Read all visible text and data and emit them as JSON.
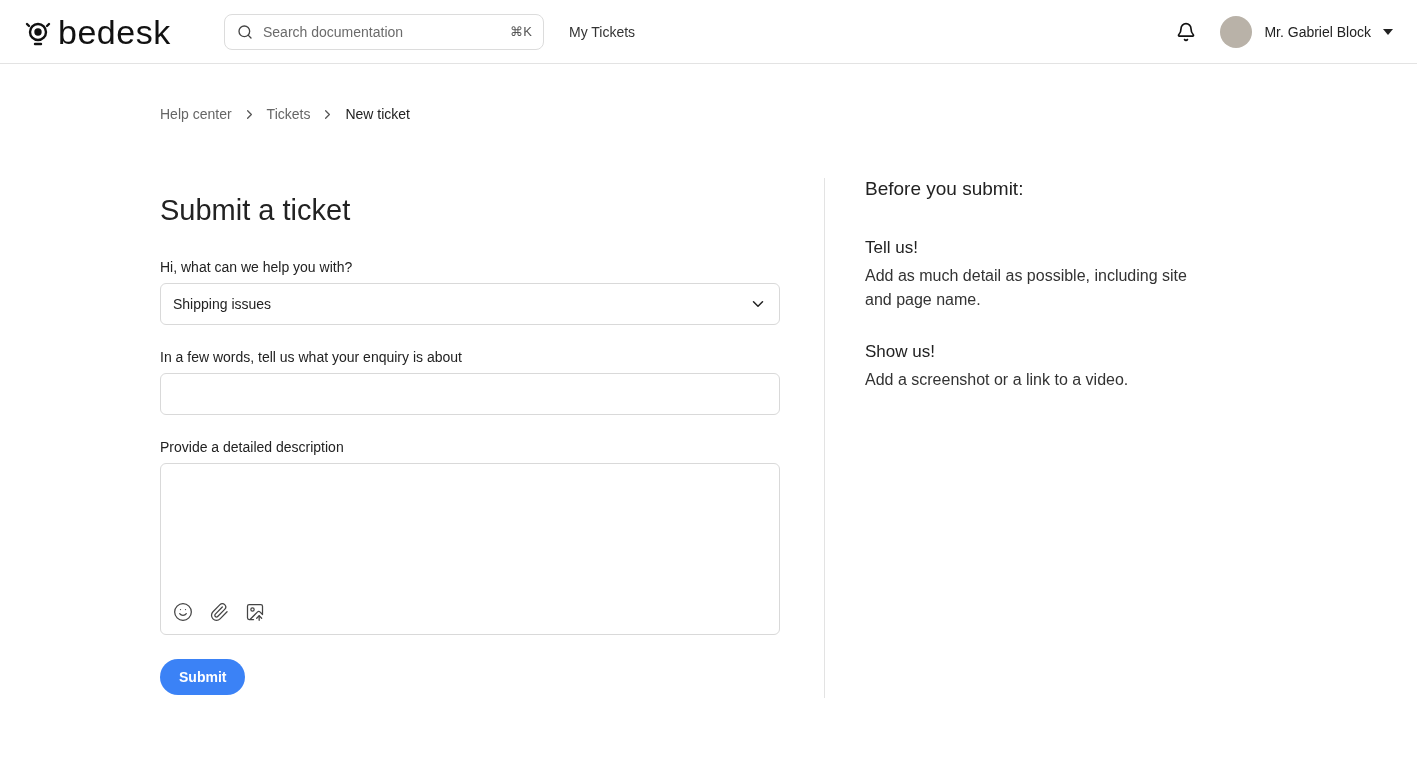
{
  "header": {
    "logo": "bedesk",
    "search": {
      "placeholder": "Search documentation",
      "shortcut": "⌘K"
    },
    "nav": "My Tickets",
    "user": "Mr. Gabriel Block"
  },
  "breadcrumbs": [
    {
      "label": "Help center",
      "current": false
    },
    {
      "label": "Tickets",
      "current": false
    },
    {
      "label": "New ticket",
      "current": true
    }
  ],
  "form": {
    "title": "Submit a ticket",
    "fields": [
      {
        "kind": "select",
        "label": "Hi, what can we help you with?",
        "value": "Shipping issues"
      },
      {
        "kind": "text",
        "label": "In a few words, tell us what your enquiry is about"
      },
      {
        "kind": "textarea",
        "label": "Provide a detailed description"
      }
    ],
    "submit": "Submit"
  },
  "aside": {
    "title": "Before you submit:",
    "tips": [
      {
        "heading": "Tell us!",
        "text": "Add as much detail as possible, including site and page name."
      },
      {
        "heading": "Show us!",
        "text": "Add a screenshot or a link to a video."
      }
    ]
  }
}
